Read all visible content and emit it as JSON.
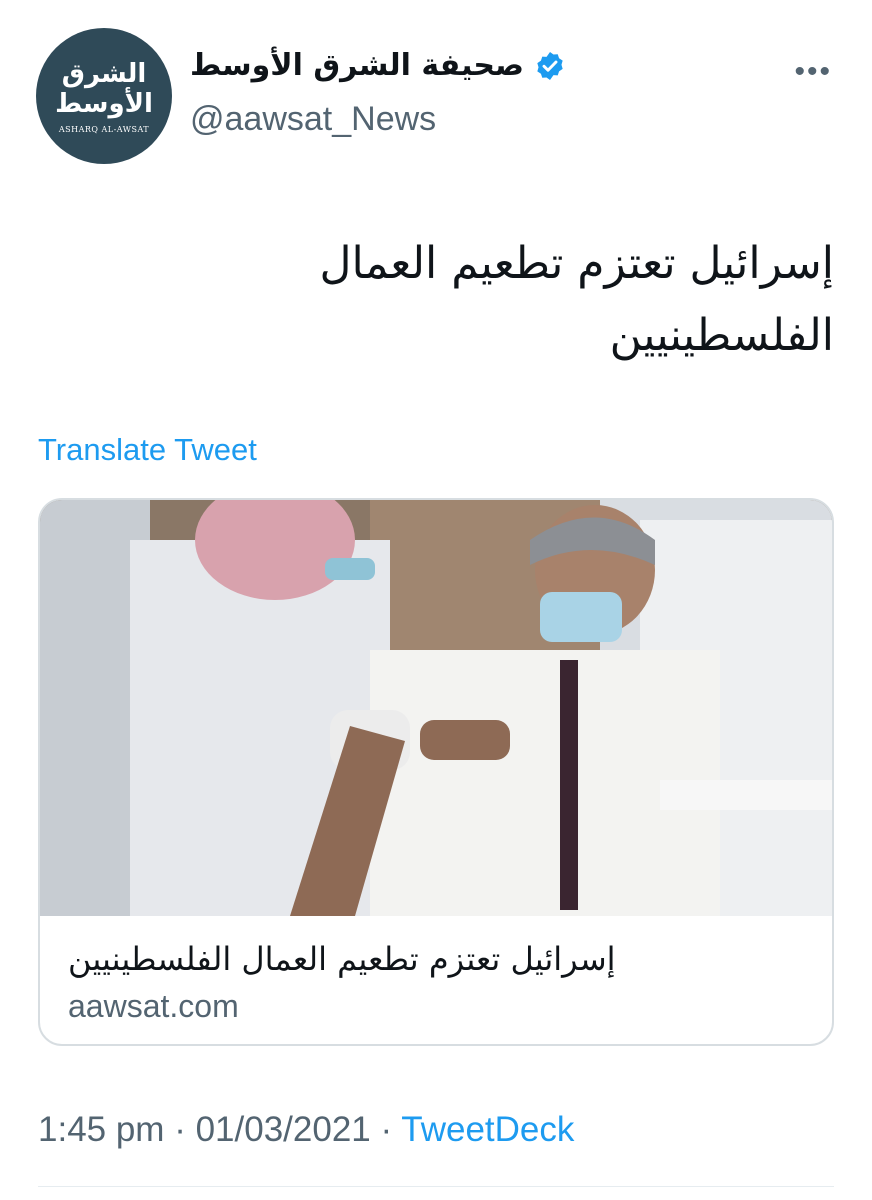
{
  "account": {
    "logo_ar_line1": "الشرق",
    "logo_ar_line2": "الأوسط",
    "logo_en": "ASHARQ AL-AWSAT",
    "display_name": "صحيفة الشرق الأوسط",
    "handle": "@aawsat_News",
    "verified_icon": "verified-badge-icon"
  },
  "tweet": {
    "text": "إسرائيل تعتزم تطعيم العمال الفلسطينيين",
    "translate_label": "Translate Tweet"
  },
  "link_card": {
    "title": "إسرائيل تعتزم تطعيم العمال الفلسطينيين",
    "domain": "aawsat.com"
  },
  "meta": {
    "time": "1:45 pm",
    "separator": "·",
    "date": "01/03/2021",
    "source": "TweetDeck"
  },
  "colors": {
    "link": "#1d9bf0",
    "secondary": "#536471",
    "avatar_bg": "#2f4a58"
  }
}
